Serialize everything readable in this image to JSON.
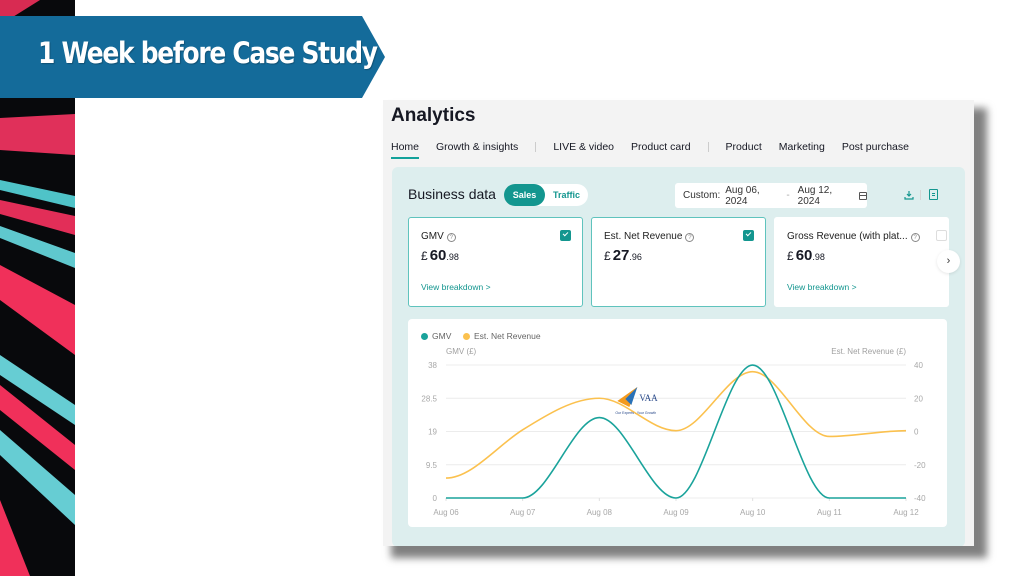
{
  "slide": {
    "banner_title": "1 Week before Case Study",
    "colors": {
      "banner": "#146b9a",
      "accent_pink": "#f0305a",
      "accent_cyan": "#66cdd3"
    }
  },
  "app": {
    "title": "Analytics",
    "tabs": [
      {
        "label": "Home",
        "active": true
      },
      {
        "label": "Growth & insights",
        "active": false
      },
      {
        "label": "LIVE & video",
        "active": false
      },
      {
        "label": "Product card",
        "active": false
      },
      {
        "label": "Product",
        "active": false
      },
      {
        "label": "Marketing",
        "active": false
      },
      {
        "label": "Post purchase",
        "active": false
      }
    ],
    "business": {
      "title": "Business data",
      "toggle": {
        "selected": "Sales",
        "other": "Traffic"
      },
      "date_range": {
        "prefix": "Custom:",
        "start": "Aug 06, 2024",
        "separator": "-",
        "end": "Aug 12, 2024"
      },
      "icons": [
        "download-icon",
        "spreadsheet-icon",
        "calendar-icon"
      ]
    },
    "metrics": [
      {
        "label": "GMV",
        "currency": "£",
        "whole": "60",
        "decimal": ".98",
        "checked": true,
        "link": "View breakdown >"
      },
      {
        "label": "Est. Net Revenue",
        "currency": "£",
        "whole": "27",
        "decimal": ".96",
        "checked": true,
        "link": ""
      },
      {
        "label": "Gross Revenue (with plat...",
        "currency": "£",
        "whole": "60",
        "decimal": ".98",
        "checked": false,
        "link": "View breakdown >"
      }
    ],
    "next_button": "›",
    "colors": {
      "accent": "#13968f",
      "gmv": "#1aa39b",
      "net_revenue": "#fbc14e",
      "panel_bg": "#ddeeee"
    },
    "watermark": {
      "brand": "VAA",
      "tagline": "Our Experts . Your Growth"
    }
  },
  "chart_data": {
    "type": "line",
    "title": "",
    "legend": [
      "GMV",
      "Est. Net Revenue"
    ],
    "legend_position": "top-left",
    "x": [
      "Aug 06",
      "Aug 07",
      "Aug 08",
      "Aug 09",
      "Aug 10",
      "Aug 11",
      "Aug 12"
    ],
    "series": [
      {
        "name": "GMV",
        "axis": "left",
        "values": [
          0,
          0,
          22.99,
          0,
          37.99,
          0,
          0
        ]
      },
      {
        "name": "Est. Net Revenue",
        "axis": "right",
        "values": [
          -28.0,
          1.0,
          20.0,
          0.5,
          36.0,
          -3.0,
          0.5
        ]
      }
    ],
    "ylabel_left": "GMV (£)",
    "ylabel_right": "Est. Net Revenue (£)",
    "yticks_left": [
      "0",
      "9.5",
      "19",
      "28.5",
      "38"
    ],
    "yticks_right": [
      "-40",
      "-20",
      "0",
      "20",
      "40"
    ],
    "ylim_left": [
      0,
      38
    ],
    "ylim_right": [
      -40,
      40
    ],
    "grid": true,
    "smooth": true
  }
}
